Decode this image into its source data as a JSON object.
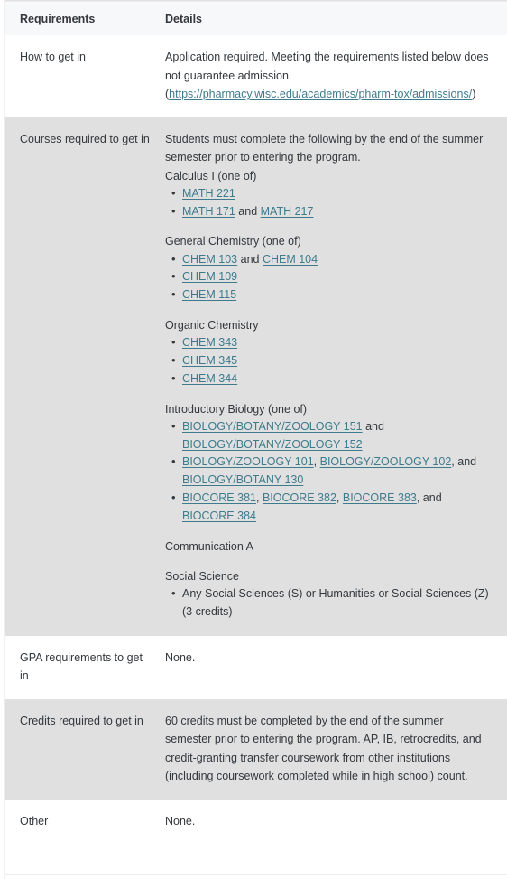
{
  "table": {
    "headers": {
      "requirements": "Requirements",
      "details": "Details"
    },
    "rows": [
      {
        "label": "How to get in",
        "shaded": false,
        "intro": "Application required. Meeting the requirements listed below does not guarantee admission. (",
        "link_text": "https://pharmacy.wisc.edu/academics/pharm-tox/admissions/",
        "outro": ")"
      },
      {
        "label": "Courses required to get in",
        "shaded": true,
        "intro": "Students must complete the following by the end of the summer semester prior to entering the program.",
        "groups": [
          {
            "title": "Calculus I (one of)",
            "items": [
              {
                "parts": [
                  {
                    "type": "link",
                    "text": "MATH  221"
                  }
                ]
              },
              {
                "parts": [
                  {
                    "type": "link",
                    "text": "MATH  171"
                  },
                  {
                    "type": "text",
                    "text": " and "
                  },
                  {
                    "type": "link",
                    "text": "MATH  217"
                  }
                ]
              }
            ]
          },
          {
            "title": "General Chemistry (one of)",
            "items": [
              {
                "parts": [
                  {
                    "type": "link",
                    "text": "CHEM  103"
                  },
                  {
                    "type": "text",
                    "text": " and "
                  },
                  {
                    "type": "link",
                    "text": "CHEM  104"
                  }
                ]
              },
              {
                "parts": [
                  {
                    "type": "link",
                    "text": "CHEM  109"
                  }
                ]
              },
              {
                "parts": [
                  {
                    "type": "link",
                    "text": "CHEM  115"
                  }
                ]
              }
            ]
          },
          {
            "title": "Organic Chemistry",
            "items": [
              {
                "parts": [
                  {
                    "type": "link",
                    "text": "CHEM  343"
                  }
                ]
              },
              {
                "parts": [
                  {
                    "type": "link",
                    "text": "CHEM  345"
                  }
                ]
              },
              {
                "parts": [
                  {
                    "type": "link",
                    "text": "CHEM  344"
                  }
                ]
              }
            ]
          },
          {
            "title": "Introductory Biology (one of)",
            "items": [
              {
                "parts": [
                  {
                    "type": "link",
                    "text": "BIOLOGY/BOTANY/ZOOLOGY  151"
                  },
                  {
                    "type": "text",
                    "text": " and "
                  },
                  {
                    "type": "link",
                    "text": "BIOLOGY/BOTANY/ZOOLOGY  152"
                  }
                ]
              },
              {
                "parts": [
                  {
                    "type": "link",
                    "text": "BIOLOGY/ZOOLOGY  101"
                  },
                  {
                    "type": "text",
                    "text": ", "
                  },
                  {
                    "type": "link",
                    "text": "BIOLOGY/ZOOLOGY  102"
                  },
                  {
                    "type": "text",
                    "text": ", and "
                  },
                  {
                    "type": "link",
                    "text": "BIOLOGY/BOTANY  130"
                  }
                ]
              },
              {
                "parts": [
                  {
                    "type": "link",
                    "text": "BIOCORE  381"
                  },
                  {
                    "type": "text",
                    "text": ", "
                  },
                  {
                    "type": "link",
                    "text": "BIOCORE  382"
                  },
                  {
                    "type": "text",
                    "text": ", "
                  },
                  {
                    "type": "link",
                    "text": "BIOCORE  383"
                  },
                  {
                    "type": "text",
                    "text": ", and "
                  },
                  {
                    "type": "link",
                    "text": "BIOCORE  384"
                  }
                ]
              }
            ]
          },
          {
            "title": "Communication A",
            "items": []
          },
          {
            "title": "Social Science",
            "items": [
              {
                "parts": [
                  {
                    "type": "text",
                    "text": "Any Social Sciences (S) or Humanities or Social Sciences (Z) (3 credits)"
                  }
                ]
              }
            ]
          }
        ]
      },
      {
        "label": "GPA requirements to get in",
        "shaded": false,
        "intro": "None."
      },
      {
        "label": "Credits required to get in",
        "shaded": true,
        "intro": "60 credits must be completed by the end of the summer semester prior to entering the program. AP, IB, retrocredits, and credit-granting transfer coursework from other institutions (including coursework completed while in high school) count."
      },
      {
        "label": "Other",
        "shaded": false,
        "intro": "None."
      }
    ]
  },
  "colors": {
    "link": "#3d7b8d",
    "text": "#33383d",
    "shaded_row_bg": "#e0e0e0",
    "header_bg": "#f7f8f9",
    "page_bg": "#ffffff"
  }
}
